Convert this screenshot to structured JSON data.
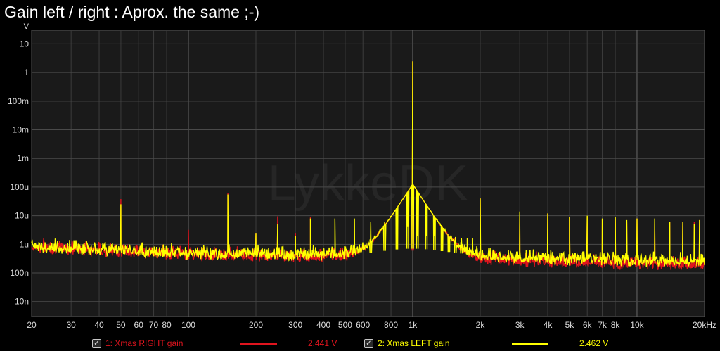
{
  "title": "Gain left / right : Aprox. the same ;-)",
  "chart_data": {
    "type": "line",
    "watermark": "LykkeDK",
    "x_scale": "log",
    "y_scale": "log",
    "xlim": [
      20,
      20000
    ],
    "ylim": [
      3e-09,
      30
    ],
    "y_unit_label": "V",
    "x_unit": "Hz",
    "grid": true,
    "x_ticks": [
      {
        "v": 20,
        "label": "20"
      },
      {
        "v": 30,
        "label": "30"
      },
      {
        "v": 40,
        "label": "40"
      },
      {
        "v": 50,
        "label": "50"
      },
      {
        "v": 60,
        "label": "60"
      },
      {
        "v": 70,
        "label": "70"
      },
      {
        "v": 80,
        "label": "80"
      },
      {
        "v": 100,
        "label": "100"
      },
      {
        "v": 200,
        "label": "200"
      },
      {
        "v": 300,
        "label": "300"
      },
      {
        "v": 400,
        "label": "400"
      },
      {
        "v": 500,
        "label": "500"
      },
      {
        "v": 600,
        "label": "600"
      },
      {
        "v": 800,
        "label": "800"
      },
      {
        "v": 1000,
        "label": "1k"
      },
      {
        "v": 2000,
        "label": "2k"
      },
      {
        "v": 3000,
        "label": "3k"
      },
      {
        "v": 4000,
        "label": "4k"
      },
      {
        "v": 5000,
        "label": "5k"
      },
      {
        "v": 6000,
        "label": "6k"
      },
      {
        "v": 7000,
        "label": "7k"
      },
      {
        "v": 8000,
        "label": "8k"
      },
      {
        "v": 10000,
        "label": "10k"
      },
      {
        "v": 20000,
        "label": "20kHz"
      }
    ],
    "y_ticks": [
      {
        "v": 10,
        "label": "10"
      },
      {
        "v": 1,
        "label": "1"
      },
      {
        "v": 0.1,
        "label": "100m"
      },
      {
        "v": 0.01,
        "label": "10m"
      },
      {
        "v": 0.001,
        "label": "1m"
      },
      {
        "v": 0.0001,
        "label": "100u"
      },
      {
        "v": 1e-05,
        "label": "10u"
      },
      {
        "v": 1e-06,
        "label": "1u"
      },
      {
        "v": 1e-07,
        "label": "100n"
      },
      {
        "v": 1e-08,
        "label": "10n"
      }
    ],
    "series": [
      {
        "name": "1: Xmas RIGHT gain",
        "reading": "2.441 V",
        "color": "#e0141e",
        "checked": true,
        "noise_floor": [
          [
            20,
            8.5e-07
          ],
          [
            50,
            6e-07
          ],
          [
            100,
            4.8e-07
          ],
          [
            300,
            4e-07
          ],
          [
            600,
            4.2e-07
          ],
          [
            900,
            6e-07
          ],
          [
            1100,
            6e-07
          ],
          [
            2000,
            3.2e-07
          ],
          [
            5000,
            2.5e-07
          ],
          [
            10000,
            2.2e-07
          ],
          [
            20000,
            2.1e-07
          ]
        ],
        "peaks": [
          [
            50,
            3.8e-05
          ],
          [
            100,
            3.2e-06
          ],
          [
            150,
            6e-05
          ],
          [
            200,
            2.5e-06
          ],
          [
            250,
            9.5e-06
          ],
          [
            300,
            2.5e-06
          ],
          [
            350,
            9e-06
          ],
          [
            1000,
            2.441
          ],
          [
            2000,
            4e-05
          ],
          [
            3000,
            1.2e-05
          ],
          [
            4000,
            1.2e-05
          ],
          [
            5000,
            9e-06
          ],
          [
            6000,
            9e-06
          ],
          [
            7000,
            7e-06
          ],
          [
            8000,
            8e-06
          ],
          [
            9000,
            6e-06
          ],
          [
            10000,
            8e-06
          ],
          [
            12000,
            7e-06
          ],
          [
            14000,
            6e-06
          ],
          [
            16000,
            6e-06
          ],
          [
            18000,
            6e-06
          ],
          [
            19000,
            7e-06
          ]
        ]
      },
      {
        "name": "2: Xmas LEFT gain",
        "reading": "2.462 V",
        "color": "#ffff00",
        "checked": true,
        "noise_floor": [
          [
            20,
            9e-07
          ],
          [
            50,
            6.5e-07
          ],
          [
            100,
            5.2e-07
          ],
          [
            300,
            4.5e-07
          ],
          [
            600,
            4.8e-07
          ],
          [
            900,
            7e-07
          ],
          [
            1100,
            7e-07
          ],
          [
            2000,
            4e-07
          ],
          [
            5000,
            3.2e-07
          ],
          [
            10000,
            2.9e-07
          ],
          [
            20000,
            2.8e-07
          ]
        ],
        "peaks": [
          [
            50,
            2.5e-05
          ],
          [
            150,
            5.5e-05
          ],
          [
            200,
            2.5e-06
          ],
          [
            250,
            5e-06
          ],
          [
            300,
            2e-06
          ],
          [
            350,
            8e-06
          ],
          [
            450,
            8e-06
          ],
          [
            550,
            8e-06
          ],
          [
            650,
            6e-06
          ],
          [
            750,
            6e-06
          ],
          [
            850,
            5e-06
          ],
          [
            950,
            4e-06
          ],
          [
            1000,
            2.462
          ],
          [
            1050,
            2e-06
          ],
          [
            1150,
            2e-06
          ],
          [
            1250,
            2e-06
          ],
          [
            1350,
            2e-06
          ],
          [
            1450,
            1.8e-06
          ],
          [
            1550,
            1.8e-06
          ],
          [
            1650,
            1.6e-06
          ],
          [
            1750,
            1.6e-06
          ],
          [
            1850,
            1.6e-06
          ],
          [
            2000,
            4e-05
          ],
          [
            3000,
            1.4e-05
          ],
          [
            4000,
            1.2e-05
          ],
          [
            5000,
            9e-06
          ],
          [
            6000,
            1e-05
          ],
          [
            7000,
            8e-06
          ],
          [
            8000,
            9e-06
          ],
          [
            9000,
            7e-06
          ],
          [
            10000,
            8e-06
          ],
          [
            12000,
            8e-06
          ],
          [
            14000,
            6e-06
          ],
          [
            16000,
            6e-06
          ],
          [
            18000,
            5e-06
          ],
          [
            19000,
            7e-06
          ]
        ]
      }
    ]
  }
}
